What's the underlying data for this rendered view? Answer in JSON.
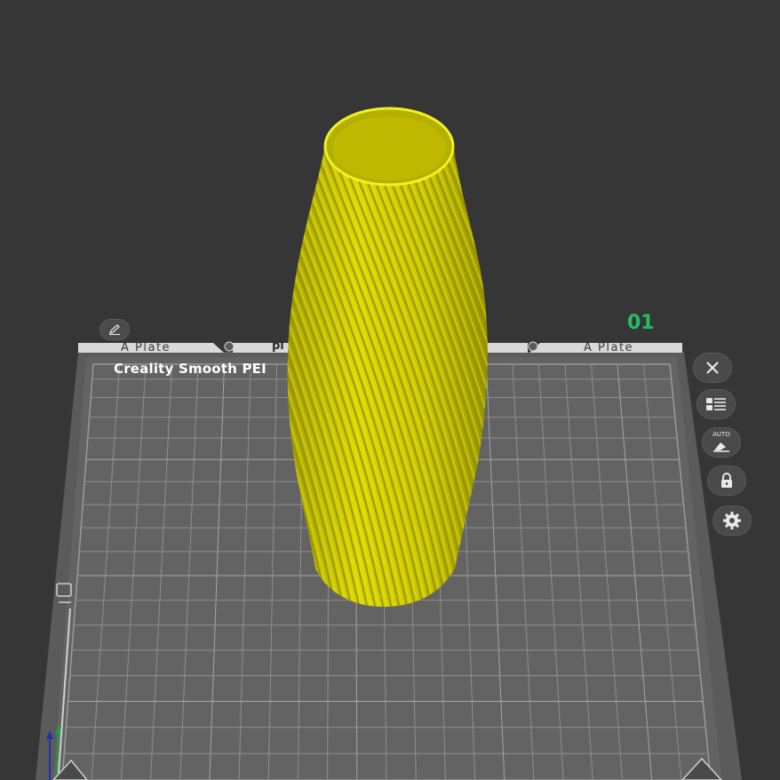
{
  "bed": {
    "label": "Creality Smooth PEI",
    "tab_left": "A Plate",
    "tab_right": "A Plate",
    "tab_center_partial": "pl",
    "plate_number": "01"
  },
  "toolbar": {
    "buttons": [
      {
        "name": "close",
        "icon": "close-icon"
      },
      {
        "name": "arrange",
        "icon": "list-icon"
      },
      {
        "name": "auto-orient",
        "icon": "auto-orient-icon",
        "label": "AUTO"
      },
      {
        "name": "lock",
        "icon": "lock-icon"
      },
      {
        "name": "settings",
        "icon": "gear-icon"
      }
    ],
    "edit_icon": "pencil-icon"
  },
  "colors": {
    "background": "#363637",
    "bed": "#5b5b5c",
    "grid": "#8a8a8a",
    "model": "#d4d000",
    "plate_number": "#20c060"
  }
}
